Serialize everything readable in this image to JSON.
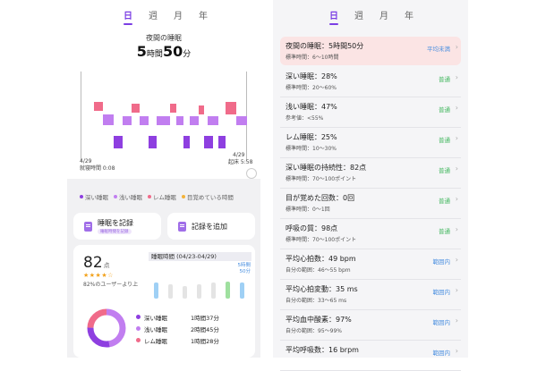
{
  "tabs": [
    "日",
    "週",
    "月",
    "年"
  ],
  "active_tab": 0,
  "night": {
    "label": "夜間の睡眠",
    "hours": "5",
    "hours_unit": "時間",
    "minutes": "50",
    "minutes_unit": "分"
  },
  "timeline": {
    "start_date": "4/29",
    "start_label": "就寝時間 0:08",
    "end_date": "4/29",
    "end_label": "起床 5:58"
  },
  "legend": [
    {
      "label": "深い睡眠",
      "color": "#8e3fe0"
    },
    {
      "label": "浅い睡眠",
      "color": "#c17ef0"
    },
    {
      "label": "レム睡眠",
      "color": "#f06b8a"
    },
    {
      "label": "目覚めている時間",
      "color": "#f4b33a"
    }
  ],
  "actions": {
    "record_sleep": "睡眠を記録",
    "record_badge": "睡眠時間を記録",
    "add_record": "記録を追加"
  },
  "score": {
    "value": "82",
    "unit": "点",
    "stars": "★★★★☆",
    "note": "82%のユーザーより上"
  },
  "duration": {
    "title": "睡眠時間 (04/23-04/29)",
    "note_line1": "5時間",
    "note_line2": "50分",
    "bar_fractions": [
      0.55,
      0.5,
      0.45,
      0.5,
      0.55,
      0.6,
      0.55
    ]
  },
  "stages": [
    {
      "name": "深い睡眠",
      "duration": "1時間37分",
      "color": "#8e3fe0"
    },
    {
      "name": "浅い睡眠",
      "duration": "2時間45分",
      "color": "#c17ef0"
    },
    {
      "name": "レム睡眠",
      "duration": "1時間28分",
      "color": "#f06b8a"
    }
  ],
  "metrics": [
    {
      "title": "夜間の睡眠：5時間50分",
      "sub": "標準時間：6～10時間",
      "status": "平均未満",
      "status_color": "#4a8fe0",
      "highlight": true
    },
    {
      "title": "深い睡眠：28%",
      "sub": "標準時間：20～60%",
      "status": "普通",
      "status_color": "#3cb55a"
    },
    {
      "title": "浅い睡眠：47%",
      "sub": "参考値：<55%",
      "status": "普通",
      "status_color": "#3cb55a"
    },
    {
      "title": "レム睡眠：25%",
      "sub": "標準時間：10～30%",
      "status": "普通",
      "status_color": "#3cb55a"
    },
    {
      "title": "深い睡眠の持続性：82点",
      "sub": "標準時間：70～100ポイント",
      "status": "普通",
      "status_color": "#3cb55a"
    },
    {
      "title": "目が覚めた回数：0回",
      "sub": "標準時間：0～1回",
      "status": "普通",
      "status_color": "#3cb55a"
    },
    {
      "title": "呼吸の質：98点",
      "sub": "標準時間：70～100ポイント",
      "status": "普通",
      "status_color": "#3cb55a"
    },
    {
      "title": "平均心拍数：49 bpm",
      "sub": "自分の範囲：46～55 bpm",
      "status": "範囲内",
      "status_color": "#4a8fe0"
    },
    {
      "title": "平均心拍変動：35 ms",
      "sub": "自分の範囲：33～65 ms",
      "status": "範囲内",
      "status_color": "#4a8fe0"
    },
    {
      "title": "平均血中酸素：97%",
      "sub": "自分の範囲：95～99%",
      "status": "範囲内",
      "status_color": "#4a8fe0"
    },
    {
      "title": "平均呼吸数：16 brpm",
      "sub": "",
      "status": "範囲内",
      "status_color": "#4a8fe0"
    }
  ]
}
